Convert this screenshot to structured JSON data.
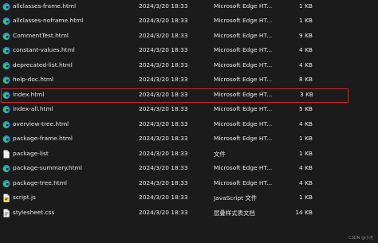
{
  "files": [
    {
      "name": "allclasses-frame.html",
      "date": "2024/3/20 18:33",
      "type": "Microsoft Edge HT...",
      "size": "1 KB",
      "icon": "edge-icon"
    },
    {
      "name": "allclasses-noframe.html",
      "date": "2024/3/20 18:33",
      "type": "Microsoft Edge HT...",
      "size": "1 KB",
      "icon": "edge-icon"
    },
    {
      "name": "CommentTest.html",
      "date": "2024/3/20 18:33",
      "type": "Microsoft Edge HT...",
      "size": "9 KB",
      "icon": "edge-icon"
    },
    {
      "name": "constant-values.html",
      "date": "2024/3/20 18:33",
      "type": "Microsoft Edge HT...",
      "size": "4 KB",
      "icon": "edge-icon"
    },
    {
      "name": "deprecated-list.html",
      "date": "2024/3/20 18:33",
      "type": "Microsoft Edge HT...",
      "size": "4 KB",
      "icon": "edge-icon"
    },
    {
      "name": "help-doc.html",
      "date": "2024/3/20 18:33",
      "type": "Microsoft Edge HT...",
      "size": "8 KB",
      "icon": "edge-icon"
    },
    {
      "name": "index.html",
      "date": "2024/3/20 18:33",
      "type": "Microsoft Edge HT...",
      "size": "3 KB",
      "icon": "edge-icon"
    },
    {
      "name": "index-all.html",
      "date": "2024/3/20 18:33",
      "type": "Microsoft Edge HT...",
      "size": "5 KB",
      "icon": "edge-icon"
    },
    {
      "name": "overview-tree.html",
      "date": "2024/3/20 18:33",
      "type": "Microsoft Edge HT...",
      "size": "4 KB",
      "icon": "edge-icon"
    },
    {
      "name": "package-frame.html",
      "date": "2024/3/20 18:33",
      "type": "Microsoft Edge HT...",
      "size": "1 KB",
      "icon": "edge-icon"
    },
    {
      "name": "package-list",
      "date": "2024/3/20 18:33",
      "type": "文件",
      "size": "1 KB",
      "icon": "file-icon"
    },
    {
      "name": "package-summary.html",
      "date": "2024/3/20 18:33",
      "type": "Microsoft Edge HT...",
      "size": "4 KB",
      "icon": "edge-icon"
    },
    {
      "name": "package-tree.html",
      "date": "2024/3/20 18:33",
      "type": "Microsoft Edge HT...",
      "size": "4 KB",
      "icon": "edge-icon"
    },
    {
      "name": "script.js",
      "date": "2024/3/20 18:33",
      "type": "JavaScript 文件",
      "size": "1 KB",
      "icon": "js-file-icon"
    },
    {
      "name": "stylesheet.css",
      "date": "2024/3/20 18:33",
      "type": "层叠样式表文档",
      "size": "14 KB",
      "icon": "css-file-icon"
    }
  ],
  "selected_index": 6,
  "selection_color": "#d0242a",
  "watermark": "CSDN @小杰"
}
